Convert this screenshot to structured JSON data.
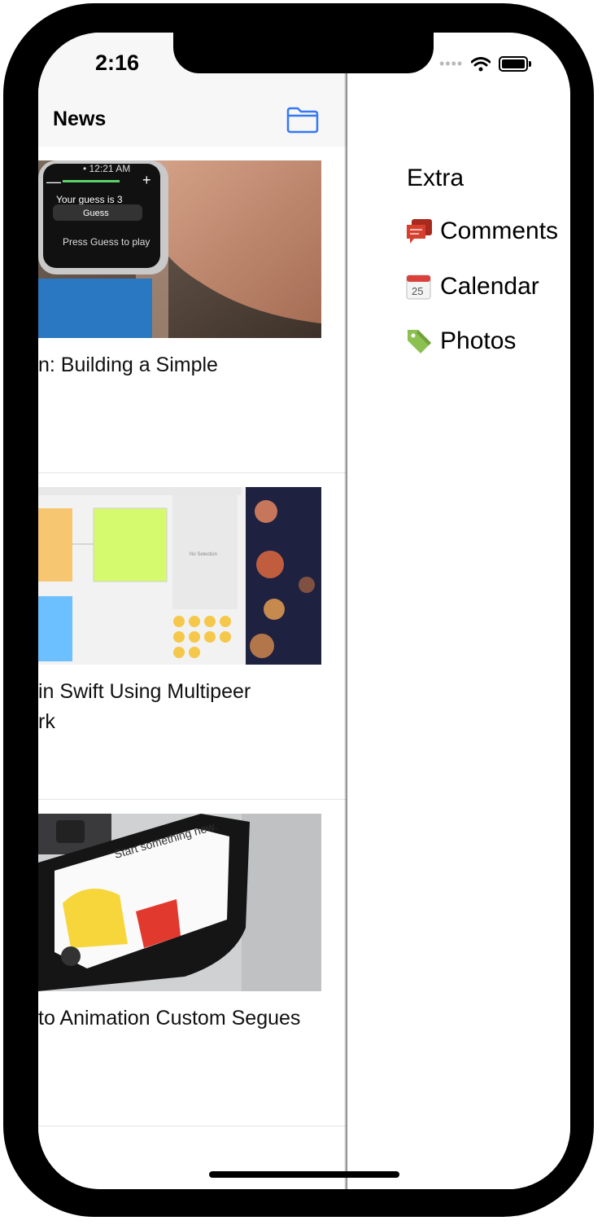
{
  "status_bar": {
    "time": "2:16",
    "signal_dots": "••••"
  },
  "navbar": {
    "title": "News",
    "folder_icon": "folder-icon"
  },
  "articles": [
    {
      "title": "n: Building a Simple",
      "image": "apple-watch-photo"
    },
    {
      "title": "in Swift Using Multipeer\nrk",
      "image": "xcode-storyboard-screenshot"
    },
    {
      "title": "to Animation Custom Segues",
      "image": "iphone-on-laptop-photo"
    }
  ],
  "drawer": {
    "title": "Extra",
    "items": [
      {
        "label": "Comments",
        "icon": "comments-icon"
      },
      {
        "label": "Calendar",
        "icon": "calendar-icon",
        "icon_text": "25"
      },
      {
        "label": "Photos",
        "icon": "tag-icon"
      }
    ]
  },
  "colors": {
    "accent": "#3478f6",
    "comments": "#d6402f",
    "tag": "#8cc152"
  }
}
